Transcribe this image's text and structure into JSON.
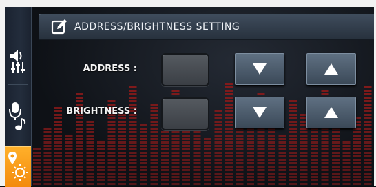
{
  "header": {
    "title": "ADDRESS/BRIGHTNESS SETTING",
    "icon": "edit-icon"
  },
  "sidebar": {
    "items": [
      {
        "name": "audio-settings",
        "icon": "speaker-equalizer-icon",
        "active": false
      },
      {
        "name": "voice-music",
        "icon": "microphone-note-icon",
        "active": false
      },
      {
        "name": "display-settings",
        "icon": "location-sun-icon",
        "active": true
      }
    ]
  },
  "settings": {
    "address": {
      "label": "ADDRESS :",
      "value": ""
    },
    "brightness": {
      "label": "BRIGHTNESS :",
      "value": ""
    }
  },
  "colors": {
    "active_tab": "#f59a14",
    "equalizer": "#8a1a1a",
    "button": "#4b5a6a"
  }
}
